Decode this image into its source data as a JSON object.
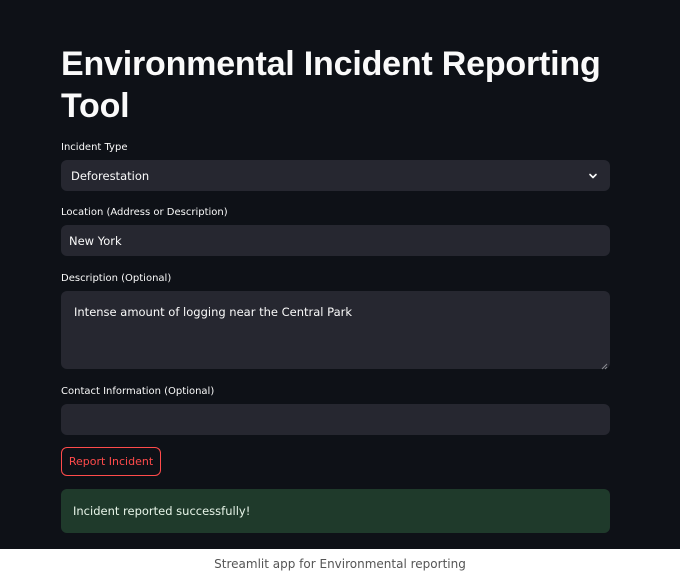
{
  "page": {
    "title": "Environmental Incident Reporting Tool"
  },
  "form": {
    "incident_type": {
      "label": "Incident Type",
      "value": "Deforestation"
    },
    "location": {
      "label": "Location (Address or Description)",
      "value": "New York"
    },
    "description": {
      "label": "Description (Optional)",
      "value": "Intense amount of logging near the Central Park"
    },
    "contact": {
      "label": "Contact Information (Optional)",
      "value": ""
    },
    "submit_label": "Report Incident"
  },
  "status": {
    "message": "Incident reported successfully!"
  },
  "caption": "Streamlit app for Environmental reporting",
  "colors": {
    "background": "#0e1117",
    "field": "#262730",
    "accent": "#ff4b4b",
    "success_bg": "#1f3a2b"
  }
}
